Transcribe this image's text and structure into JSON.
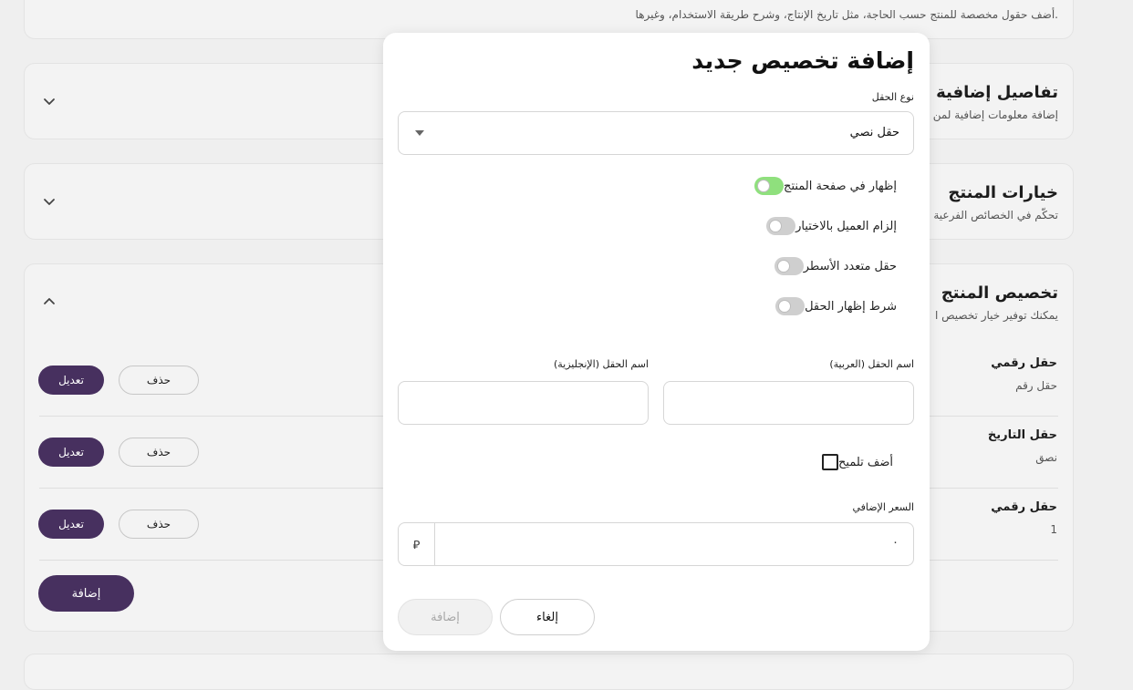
{
  "background": {
    "top_card": {
      "description": "أضف حقول مخصصة للمنتج حسب الحاجة، مثل تاريخ الإنتاج، وشرح طريقة الاستخدام، وغيرها."
    },
    "extra_details": {
      "title": "تفاصيل إضافية عن",
      "description": "إضافة معلومات إضافية لمن"
    },
    "product_options": {
      "title": "خيارات المنتج",
      "description": "تحكّم في الخصائص الفرعية"
    },
    "product_customization": {
      "title": "تخصيص المنتج",
      "description": "يمكنك توفير خيار تخصيص ا",
      "rows": [
        {
          "title": "حقل رقمي",
          "subtitle": "حقل رقم",
          "edit_label": "تعديل",
          "delete_label": "حذف"
        },
        {
          "title": "حقل التاريخ",
          "subtitle": "نصق",
          "edit_label": "تعديل",
          "delete_label": "حذف"
        },
        {
          "title": "حقل رقمي",
          "subtitle": "1",
          "edit_label": "تعديل",
          "delete_label": "حذف"
        }
      ],
      "add_label": "إضافة"
    }
  },
  "modal": {
    "title": "إضافة تخصيص جديد",
    "field_type": {
      "label": "نوع الحقل",
      "value": "حقل نصي"
    },
    "toggles": [
      {
        "label": "إظهار في صفحة المنتج",
        "on": true
      },
      {
        "label": "إلزام العميل بالاختيار",
        "on": false
      },
      {
        "label": "حقل متعدد الأسطر",
        "on": false
      },
      {
        "label": "شرط إظهار الحقل",
        "on": false
      }
    ],
    "name_ar": {
      "label": "اسم الحقل (العربية)",
      "value": ""
    },
    "name_en": {
      "label": "اسم الحقل (الإنجليزية)",
      "value": ""
    },
    "hint": {
      "label": "أضف تلميح",
      "checked": false
    },
    "extra_price": {
      "label": "السعر الإضافي",
      "value": "٠",
      "currency_symbol": "⃁"
    },
    "cancel_label": "إلغاء",
    "submit_label": "إضافة"
  },
  "colors": {
    "primary": "#47305f",
    "toggle_on": "#8fe07d",
    "toggle_off": "#cfcfcf"
  }
}
